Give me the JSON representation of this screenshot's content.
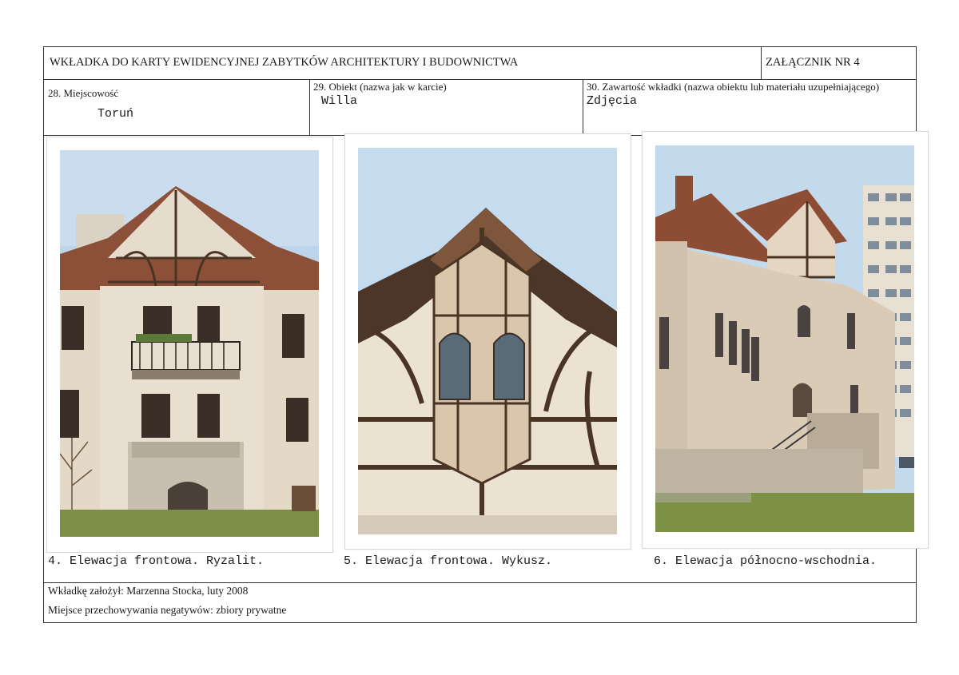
{
  "header": {
    "title": "WKŁADKA DO KARTY EWIDENCYJNEJ ZABYTKÓW ARCHITEKTURY I BUDOWNICTWA",
    "annex": "ZAŁĄCZNIK NR 4"
  },
  "fields": {
    "locality_label": "28. Miejscowość",
    "locality_value": "Toruń",
    "object_label": "29. Obiekt (nazwa jak w karcie)",
    "object_value": "Willa",
    "contents_label": "30. Zawartość wkładki (nazwa obiektu lub materiału uzupełniającego)",
    "contents_value": "Zdjęcia"
  },
  "photos": [
    {
      "caption": "4. Elewacja frontowa. Ryzalit.",
      "icon": "house-photo-front-risalit"
    },
    {
      "caption": "5. Elewacja frontowa. Wykusz.",
      "icon": "house-photo-oriel"
    },
    {
      "caption": "6. Elewacja północno-wschodnia.",
      "icon": "house-photo-northeast"
    }
  ],
  "footer": {
    "author": "Wkładkę założył:  Marzenna Stocka, luty 2008",
    "negatives": "Miejsce przechowywania negatywów: zbiory prywatne"
  },
  "colors": {
    "sky": "#b9d3ea",
    "wall": "#e7dccb",
    "roof": "#8a4a33",
    "timber": "#4a3424",
    "grass": "#7c8f44"
  }
}
